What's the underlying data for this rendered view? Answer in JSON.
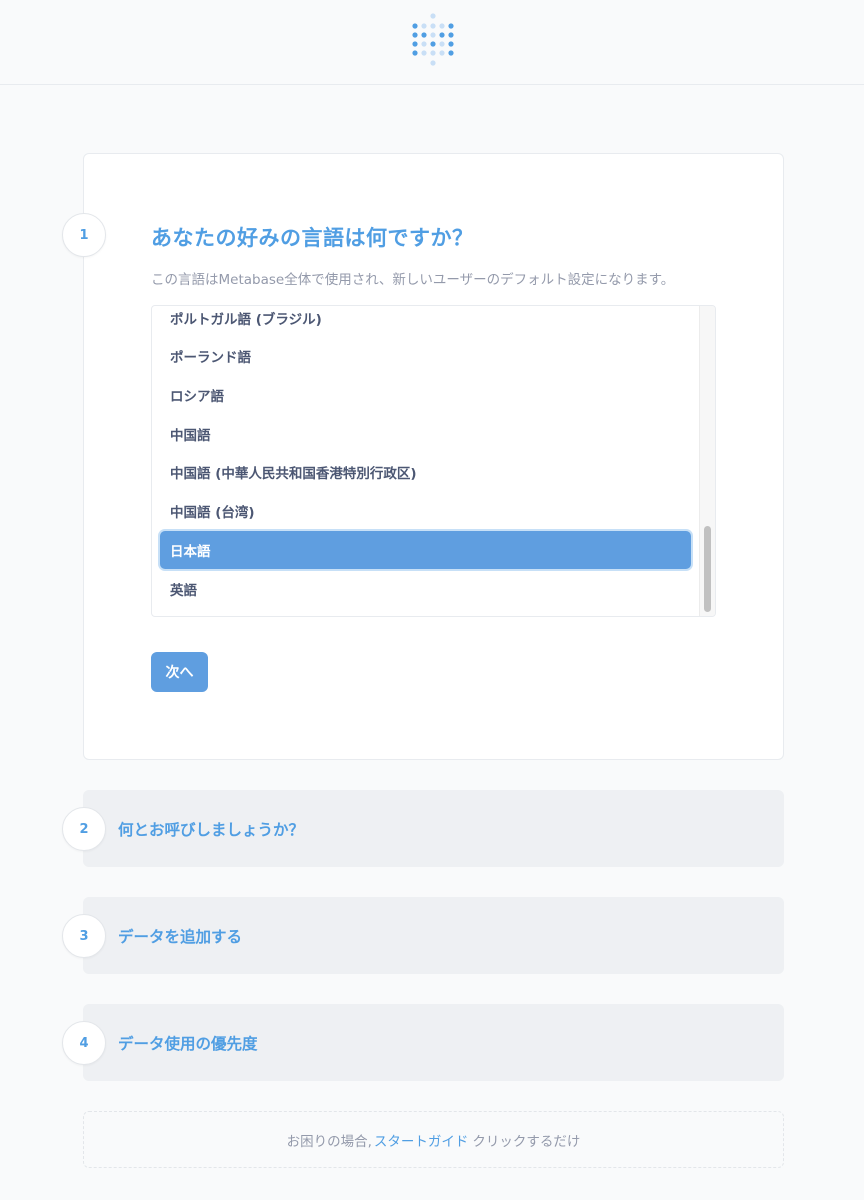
{
  "header": {
    "logo": "metabase-logo-icon"
  },
  "step1": {
    "number": "1",
    "title": "あなたの好みの言語は何ですか？",
    "description": "この言語はMetabase全体で使用され、新しいユーザーのデフォルト設定になります。",
    "languages": [
      "ポルトガル語 (ブラジル)",
      "ポーランド語",
      "ロシア語",
      "中国語",
      "中国語 (中華人民共和国香港特別行政区)",
      "中国語 (台湾)",
      "日本語",
      "英語"
    ],
    "selected_language": "日本語",
    "next_label": "次へ"
  },
  "step2": {
    "number": "2",
    "title": "何とお呼びしましょうか？"
  },
  "step3": {
    "number": "3",
    "title": "データを追加する"
  },
  "step4": {
    "number": "4",
    "title": "データ使用の優先度"
  },
  "help": {
    "prefix": "お困りの場合,",
    "link": "スタートガイド",
    "suffix": "クリックするだけ"
  },
  "colors": {
    "brand": "#509ee3",
    "selected": "#5f9ee0",
    "text": "#4c5773",
    "muted": "#949aab"
  }
}
